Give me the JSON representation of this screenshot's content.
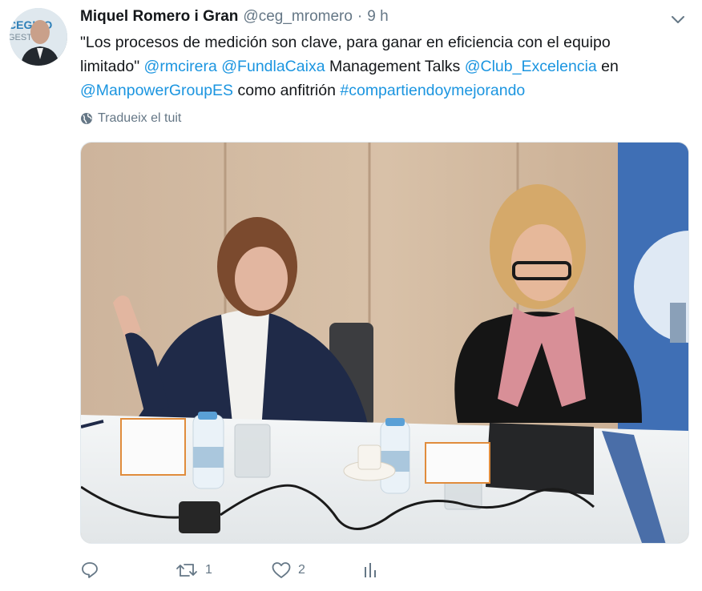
{
  "tweet": {
    "author_name": "Miquel Romero i Gran",
    "author_handle": "@ceg_mromero",
    "separator": "·",
    "timestamp": "9 h",
    "text_segments": [
      {
        "text": "\"Los procesos de medición son clave, para ganar en eficiencia con el equipo limitado\" ",
        "link": false
      },
      {
        "text": "@rmcirera",
        "link": true
      },
      {
        "text": " ",
        "link": false
      },
      {
        "text": "@FundlaCaixa",
        "link": true
      },
      {
        "text": " Management Talks ",
        "link": false
      },
      {
        "text": "@Club_Excelencia",
        "link": true
      },
      {
        "text": " en ",
        "link": false
      },
      {
        "text": "@ManpowerGroupES",
        "link": true
      },
      {
        "text": " como anfitrión ",
        "link": false
      },
      {
        "text": "#compartiendoymejorando",
        "link": true
      }
    ],
    "translate_label": "Tradueix el tuit",
    "avatar_text": "CEGINO GESTION"
  },
  "actions": {
    "reply_count": "",
    "retweet_count": "1",
    "like_count": "2"
  },
  "colors": {
    "link": "#1b95e0",
    "muted": "#657786",
    "text": "#14171a"
  },
  "icons": [
    "chevron-down-icon",
    "globe-icon",
    "reply-icon",
    "retweet-icon",
    "heart-icon",
    "analytics-icon"
  ]
}
